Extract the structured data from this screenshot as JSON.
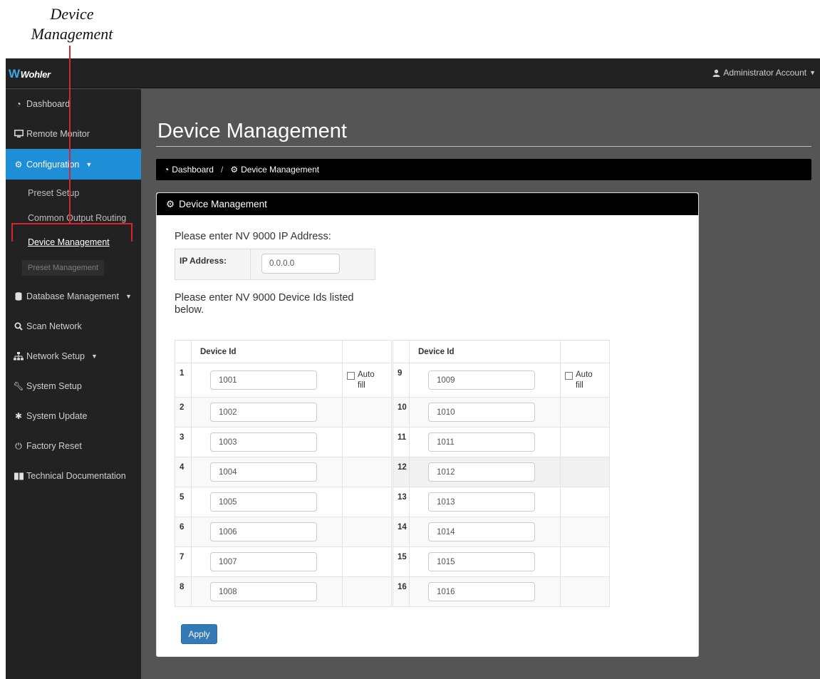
{
  "callout": {
    "text_line1": "Device",
    "text_line2": "Management"
  },
  "topbar": {
    "brand": "Wohler",
    "account": "Administrator Account"
  },
  "sidebar": {
    "dashboard": "Dashboard",
    "remote_monitor": "Remote Monitor",
    "configuration": "Configuration",
    "preset_setup": "Preset Setup",
    "common_output_routing": "Common Output Routing",
    "device_management": "Device Management",
    "preset_management": "Preset Management",
    "database_management": "Database Management",
    "scan_network": "Scan Network",
    "network_setup": "Network Setup",
    "system_setup": "System Setup",
    "system_update": "System Update",
    "factory_reset": "Factory Reset",
    "technical_documentation": "Technical Documentation"
  },
  "main": {
    "title": "Device Management",
    "breadcrumb": {
      "home": "Dashboard",
      "separator": "/",
      "current": "Device Management"
    },
    "panel_title": "Device Management",
    "ip_prompt": "Please enter NV 9000 IP Address:",
    "ip_label": "IP Address:",
    "ip_value": "0.0.0.0",
    "ids_prompt_line1": "Please enter NV 9000 Device Ids listed",
    "ids_prompt_line2": "below.",
    "device_id_header": "Device Id",
    "autofill_line1": "Auto",
    "autofill_line2": "fill",
    "left_rows": [
      {
        "num": "1",
        "value": "1001"
      },
      {
        "num": "2",
        "value": "1002"
      },
      {
        "num": "3",
        "value": "1003"
      },
      {
        "num": "4",
        "value": "1004"
      },
      {
        "num": "5",
        "value": "1005"
      },
      {
        "num": "6",
        "value": "1006"
      },
      {
        "num": "7",
        "value": "1007"
      },
      {
        "num": "8",
        "value": "1008"
      }
    ],
    "right_rows": [
      {
        "num": "9",
        "value": "1009"
      },
      {
        "num": "10",
        "value": "1010"
      },
      {
        "num": "11",
        "value": "1011"
      },
      {
        "num": "12",
        "value": "1012"
      },
      {
        "num": "13",
        "value": "1013"
      },
      {
        "num": "14",
        "value": "1014"
      },
      {
        "num": "15",
        "value": "1015"
      },
      {
        "num": "16",
        "value": "1016"
      }
    ],
    "apply_label": "Apply"
  },
  "colors": {
    "accent": "#1e8fd6",
    "callout": "#d9232d",
    "button": "#337ab7"
  }
}
